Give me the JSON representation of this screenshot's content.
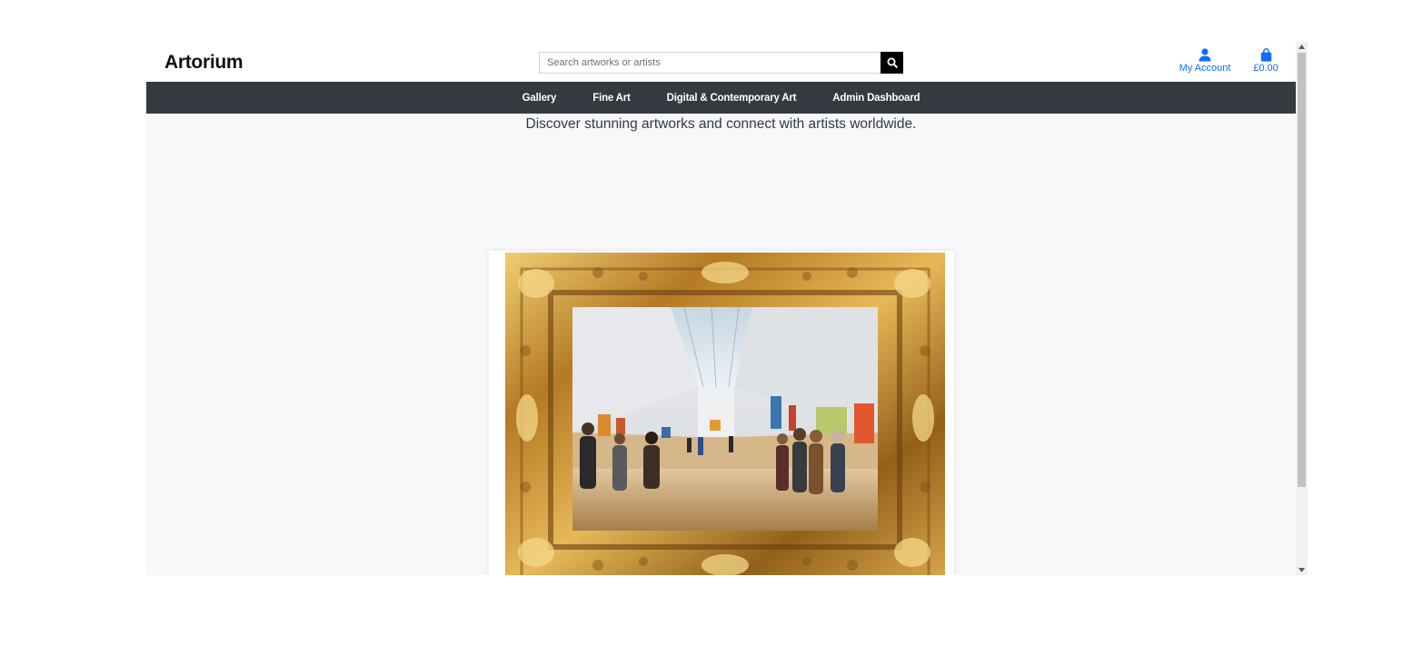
{
  "header": {
    "logo": "Artorium",
    "search_placeholder": "Search artworks or artists",
    "account_label": "My Account",
    "cart_total": "£0.00"
  },
  "nav": {
    "items": [
      "Gallery",
      "Fine Art",
      "Digital & Contemporary Art",
      "Admin Dashboard"
    ]
  },
  "hero": {
    "tagline": "Discover stunning artworks and connect with artists worldwide."
  },
  "colors": {
    "nav_bg": "#343a40",
    "accent": "#0d6efd",
    "page_bg": "#f7f8fa"
  }
}
